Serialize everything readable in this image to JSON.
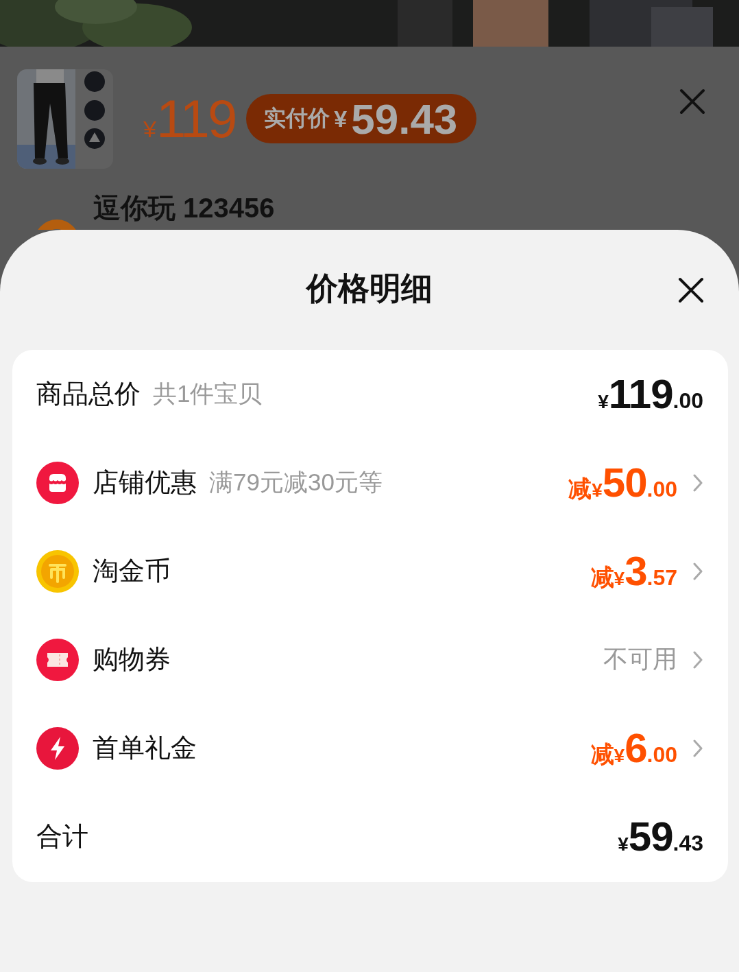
{
  "product_panel": {
    "price_currency": "¥",
    "price": "119",
    "pay_label": "实付价",
    "pay_currency": "¥",
    "pay_amount": "59.43",
    "shop_name": "逗你玩 123456"
  },
  "sheet": {
    "title": "价格明细",
    "rows": [
      {
        "kind": "total",
        "label": "商品总价",
        "note": "共1件宝贝",
        "amount": {
          "currency": "¥",
          "integer": "119",
          "decimal": ".00"
        }
      },
      {
        "kind": "discount",
        "label": "店铺优惠",
        "note": "满79元减30元等",
        "amount": {
          "prefix": "减",
          "currency": "¥",
          "integer": "50",
          "decimal": ".00"
        }
      },
      {
        "kind": "discount",
        "label": "淘金币",
        "amount": {
          "prefix": "减",
          "currency": "¥",
          "integer": "3",
          "decimal": ".57"
        }
      },
      {
        "kind": "unavailable",
        "label": "购物券",
        "status": "不可用"
      },
      {
        "kind": "discount",
        "label": "首单礼金",
        "amount": {
          "prefix": "减",
          "currency": "¥",
          "integer": "6",
          "decimal": ".00"
        }
      },
      {
        "kind": "sum",
        "label": "合计",
        "amount": {
          "currency": "¥",
          "integer": "59",
          "decimal": ".43"
        }
      }
    ]
  }
}
